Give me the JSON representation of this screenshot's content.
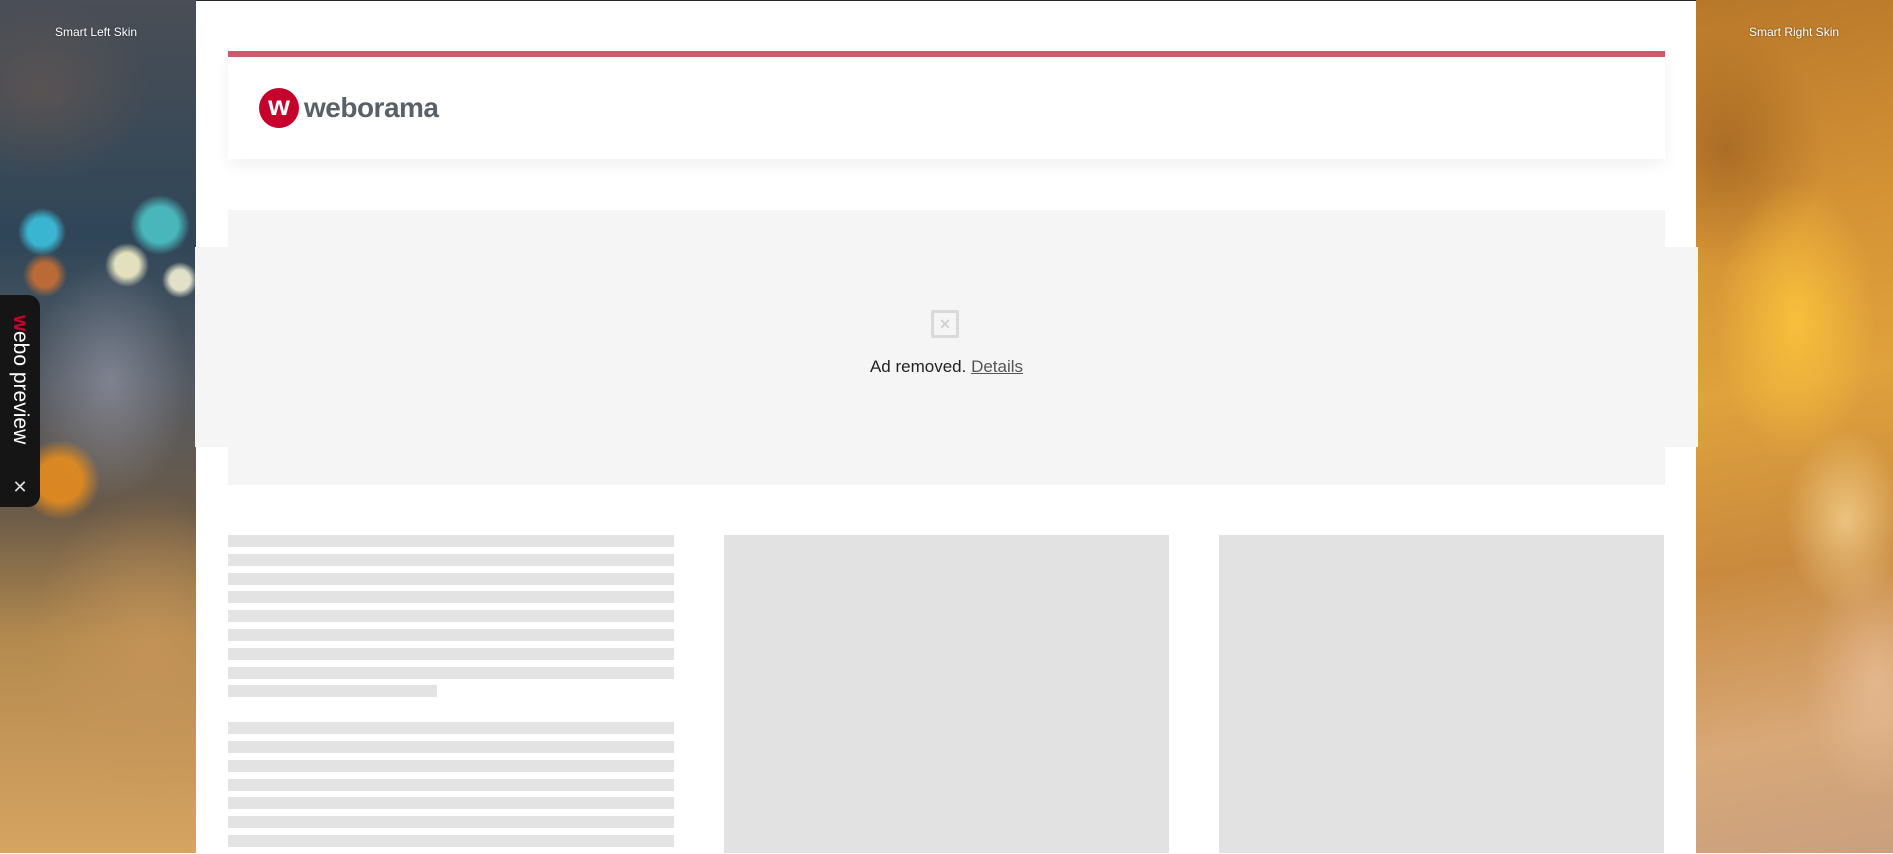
{
  "skins": {
    "left_label": "Smart Left Skin",
    "right_label": "Smart Right Skin"
  },
  "header": {
    "logo_mark": "w",
    "logo_text": "weborama",
    "accent_color": "#d0596c",
    "brand_color": "#c5002c"
  },
  "ad": {
    "icon": "broken-image-icon",
    "message": "Ad removed.",
    "details_link": "Details"
  },
  "preview_tab": {
    "brand_letter": "w",
    "label": "ebo preview",
    "close_icon": "✕"
  }
}
